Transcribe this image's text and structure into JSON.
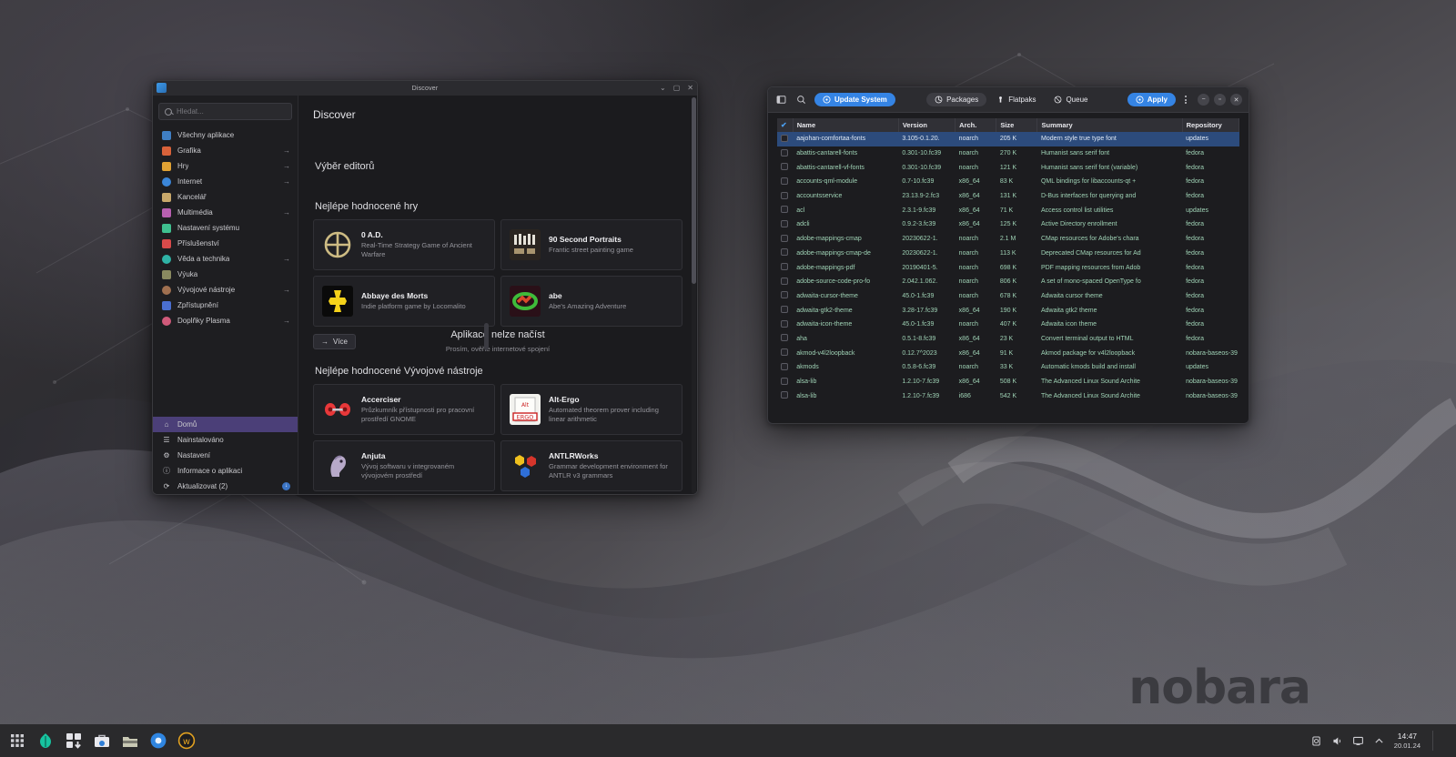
{
  "desktop": {
    "wallpaper_brand": "nobara",
    "accent_color": "#3584e4",
    "selection_color": "#2c4b7c"
  },
  "discover": {
    "window_title": "Discover",
    "page_title": "Discover",
    "search": {
      "placeholder": "Hledat...",
      "value": "",
      "icon": "search-icon"
    },
    "categories": [
      {
        "label": "Všechny aplikace",
        "icon": "all-apps-icon",
        "color": "#3f7fc4",
        "arrow": ""
      },
      {
        "label": "Grafika",
        "icon": "graphics-icon",
        "color": "#d8623a",
        "arrow": "→"
      },
      {
        "label": "Hry",
        "icon": "games-icon",
        "color": "#e0a234",
        "arrow": "→"
      },
      {
        "label": "Internet",
        "icon": "internet-icon",
        "color": "#3b86d8",
        "arrow": "→"
      },
      {
        "label": "Kancelář",
        "icon": "office-icon",
        "color": "#c8a86a",
        "arrow": ""
      },
      {
        "label": "Multimédia",
        "icon": "multimedia-icon",
        "color": "#b85fb0",
        "arrow": "→"
      },
      {
        "label": "Nastavení systému",
        "icon": "system-settings-icon",
        "color": "#3fbf8f",
        "arrow": ""
      },
      {
        "label": "Příslušenství",
        "icon": "accessories-icon",
        "color": "#d84a4a",
        "arrow": ""
      },
      {
        "label": "Věda a technika",
        "icon": "science-icon",
        "color": "#2fb3a6",
        "arrow": "→"
      },
      {
        "label": "Výuka",
        "icon": "education-icon",
        "color": "#8a8a60",
        "arrow": ""
      },
      {
        "label": "Vývojové nástroje",
        "icon": "development-icon",
        "color": "#a07050",
        "arrow": "→"
      },
      {
        "label": "Zpřístupnění",
        "icon": "accessibility-icon",
        "color": "#4a6fd0",
        "arrow": ""
      },
      {
        "label": "Doplňky Plasma",
        "icon": "plasma-addons-icon",
        "color": "#d05a7a",
        "arrow": "→"
      }
    ],
    "bottom_nav": [
      {
        "label": "Domů",
        "icon": "home-icon",
        "glyph": "⌂",
        "active": true,
        "badge": ""
      },
      {
        "label": "Nainstalováno",
        "icon": "installed-icon",
        "glyph": "☰",
        "active": false,
        "badge": ""
      },
      {
        "label": "Nastavení",
        "icon": "settings-gear-icon",
        "glyph": "⚙",
        "active": false,
        "badge": ""
      },
      {
        "label": "Informace o aplikaci",
        "icon": "about-info-icon",
        "glyph": "ⓘ",
        "active": false,
        "badge": ""
      },
      {
        "label": "Aktualizovat (2)",
        "icon": "update-icon",
        "glyph": "⟳",
        "active": false,
        "badge": "↓"
      }
    ],
    "editors_choice_heading": "Výběr editorů",
    "games_heading": "Nejlépe hodnocené hry",
    "games": [
      {
        "name": "0 A.D.",
        "desc": "Real-Time Strategy Game of Ancient Warfare",
        "icon": "zero-ad-icon"
      },
      {
        "name": "90 Second Portraits",
        "desc": "Frantic street painting game",
        "icon": "ninety-second-portraits-icon"
      },
      {
        "name": "Abbaye des Morts",
        "desc": "Indie platform game by Locomalito",
        "icon": "abbaye-des-morts-icon"
      },
      {
        "name": "abe",
        "desc": "Abe's Amazing Adventure",
        "icon": "abe-icon"
      }
    ],
    "more_button": "Více",
    "error_title": "Aplikace nelze načíst",
    "error_sub": "Prosím, ověřte internetové spojení",
    "devtools_heading": "Nejlépe hodnocené Vývojové nástroje",
    "devtools": [
      {
        "name": "Accerciser",
        "desc": "Průzkumník přístupnosti pro pracovní prostředí GNOME",
        "icon": "accerciser-icon"
      },
      {
        "name": "Alt-Ergo",
        "desc": "Automated theorem prover including linear arithmetic",
        "icon": "alt-ergo-icon"
      },
      {
        "name": "Anjuta",
        "desc": "Vývoj softwaru v integrovaném vývojovém prostředí",
        "icon": "anjuta-icon"
      },
      {
        "name": "ANTLRWorks",
        "desc": "Grammar development environment for ANTLR v3 grammars",
        "icon": "antlrworks-icon"
      }
    ],
    "window_buttons": {
      "minimize": "⌄",
      "maximize": "▢",
      "close": "✕"
    }
  },
  "package_manager": {
    "toolbar": {
      "sidebar_toggle_icon": "sidebar-toggle-icon",
      "search_icon": "search-icon",
      "update_system_label": "Update System",
      "update_system_icon": "refresh-circle-icon",
      "packages_label": "Packages",
      "packages_icon": "package-icon",
      "flatpaks_label": "Flatpaks",
      "flatpaks_icon": "flatpak-icon",
      "queue_label": "Queue",
      "queue_icon": "queue-icon",
      "apply_label": "Apply",
      "apply_icon": "apply-circle-icon",
      "menu_icon": "kebab-menu-icon",
      "minimize_icon": "minimize-icon",
      "maximize_icon": "maximize-icon",
      "close_icon": "close-icon"
    },
    "columns": [
      "Name",
      "Version",
      "Arch.",
      "Size",
      "Summary",
      "Repository"
    ],
    "rows": [
      {
        "checked": false,
        "selected": true,
        "name": "aajohan-comfortaa-fonts",
        "version": "3.105-0.1.20.",
        "arch": "noarch",
        "size": "205 K",
        "summary": "Modern style true type font",
        "repo": "updates"
      },
      {
        "checked": false,
        "selected": false,
        "name": "abattis-cantarell-fonts",
        "version": "0.301-10.fc39",
        "arch": "noarch",
        "size": "270 K",
        "summary": "Humanist sans serif font",
        "repo": "fedora"
      },
      {
        "checked": false,
        "selected": false,
        "name": "abattis-cantarell-vf-fonts",
        "version": "0.301-10.fc39",
        "arch": "noarch",
        "size": "121 K",
        "summary": "Humanist sans serif font (variable)",
        "repo": "fedora"
      },
      {
        "checked": false,
        "selected": false,
        "name": "accounts-qml-module",
        "version": "0.7-10.fc39",
        "arch": "x86_64",
        "size": "83 K",
        "summary": "QML bindings for libaccounts-qt +",
        "repo": "fedora"
      },
      {
        "checked": false,
        "selected": false,
        "name": "accountsservice",
        "version": "23.13.9-2.fc3",
        "arch": "x86_64",
        "size": "131 K",
        "summary": "D-Bus interfaces for querying and",
        "repo": "fedora"
      },
      {
        "checked": false,
        "selected": false,
        "name": "acl",
        "version": "2.3.1-9.fc39",
        "arch": "x86_64",
        "size": "71 K",
        "summary": "Access control list utilities",
        "repo": "updates"
      },
      {
        "checked": false,
        "selected": false,
        "name": "adcli",
        "version": "0.9.2-3.fc39",
        "arch": "x86_64",
        "size": "125 K",
        "summary": "Active Directory enrollment",
        "repo": "fedora"
      },
      {
        "checked": false,
        "selected": false,
        "name": "adobe-mappings-cmap",
        "version": "20230622-1.",
        "arch": "noarch",
        "size": "2.1 M",
        "summary": "CMap resources for Adobe's chara",
        "repo": "fedora"
      },
      {
        "checked": false,
        "selected": false,
        "name": "adobe-mappings-cmap-de",
        "version": "20230622-1.",
        "arch": "noarch",
        "size": "113 K",
        "summary": "Deprecated CMap resources for Ad",
        "repo": "fedora"
      },
      {
        "checked": false,
        "selected": false,
        "name": "adobe-mappings-pdf",
        "version": "20190401-5.",
        "arch": "noarch",
        "size": "698 K",
        "summary": "PDF mapping resources from Adob",
        "repo": "fedora"
      },
      {
        "checked": false,
        "selected": false,
        "name": "adobe-source-code-pro-fo",
        "version": "2.042.1.062.",
        "arch": "noarch",
        "size": "806 K",
        "summary": "A set of mono-spaced OpenType fo",
        "repo": "fedora"
      },
      {
        "checked": false,
        "selected": false,
        "name": "adwaita-cursor-theme",
        "version": "45.0-1.fc39",
        "arch": "noarch",
        "size": "678 K",
        "summary": "Adwaita cursor theme",
        "repo": "fedora"
      },
      {
        "checked": false,
        "selected": false,
        "name": "adwaita-gtk2-theme",
        "version": "3.28-17.fc39",
        "arch": "x86_64",
        "size": "190 K",
        "summary": "Adwaita gtk2 theme",
        "repo": "fedora"
      },
      {
        "checked": false,
        "selected": false,
        "name": "adwaita-icon-theme",
        "version": "45.0-1.fc39",
        "arch": "noarch",
        "size": "407 K",
        "summary": "Adwaita icon theme",
        "repo": "fedora"
      },
      {
        "checked": false,
        "selected": false,
        "name": "aha",
        "version": "0.5.1-8.fc39",
        "arch": "x86_64",
        "size": "23 K",
        "summary": "Convert terminal output to HTML",
        "repo": "fedora"
      },
      {
        "checked": false,
        "selected": false,
        "name": "akmod-v4l2loopback",
        "version": "0.12.7^2023",
        "arch": "x86_64",
        "size": "91 K",
        "summary": "Akmod package for v4l2loopback",
        "repo": "nobara-baseos-39"
      },
      {
        "checked": false,
        "selected": false,
        "name": "akmods",
        "version": "0.5.8-6.fc39",
        "arch": "noarch",
        "size": "33 K",
        "summary": "Automatic kmods build and install",
        "repo": "updates"
      },
      {
        "checked": false,
        "selected": false,
        "name": "alsa-lib",
        "version": "1.2.10-7.fc39",
        "arch": "x86_64",
        "size": "508 K",
        "summary": "The Advanced Linux Sound Archite",
        "repo": "nobara-baseos-39"
      },
      {
        "checked": false,
        "selected": false,
        "name": "alsa-lib",
        "version": "1.2.10-7.fc39",
        "arch": "i686",
        "size": "542 K",
        "summary": "The Advanced Linux Sound Archite",
        "repo": "nobara-baseos-39"
      }
    ]
  },
  "taskbar": {
    "apps": [
      {
        "name": "app-launcher",
        "icon": "grid-launcher-icon"
      },
      {
        "name": "nobara-welcome",
        "icon": "nobara-leaf-icon"
      },
      {
        "name": "software-updater",
        "icon": "update-grid-icon"
      },
      {
        "name": "package-manager",
        "icon": "toolbox-icon"
      },
      {
        "name": "file-manager",
        "icon": "folder-icon"
      },
      {
        "name": "web-browser",
        "icon": "browser-icon"
      },
      {
        "name": "discover",
        "icon": "discover-icon"
      }
    ],
    "tray": [
      {
        "name": "clipboard",
        "icon": "clipboard-icon"
      },
      {
        "name": "volume",
        "icon": "volume-icon"
      },
      {
        "name": "display",
        "icon": "display-icon"
      },
      {
        "name": "show-hidden",
        "icon": "chevron-up-icon"
      }
    ],
    "clock_time": "14:47",
    "clock_date": "20.01.24"
  }
}
